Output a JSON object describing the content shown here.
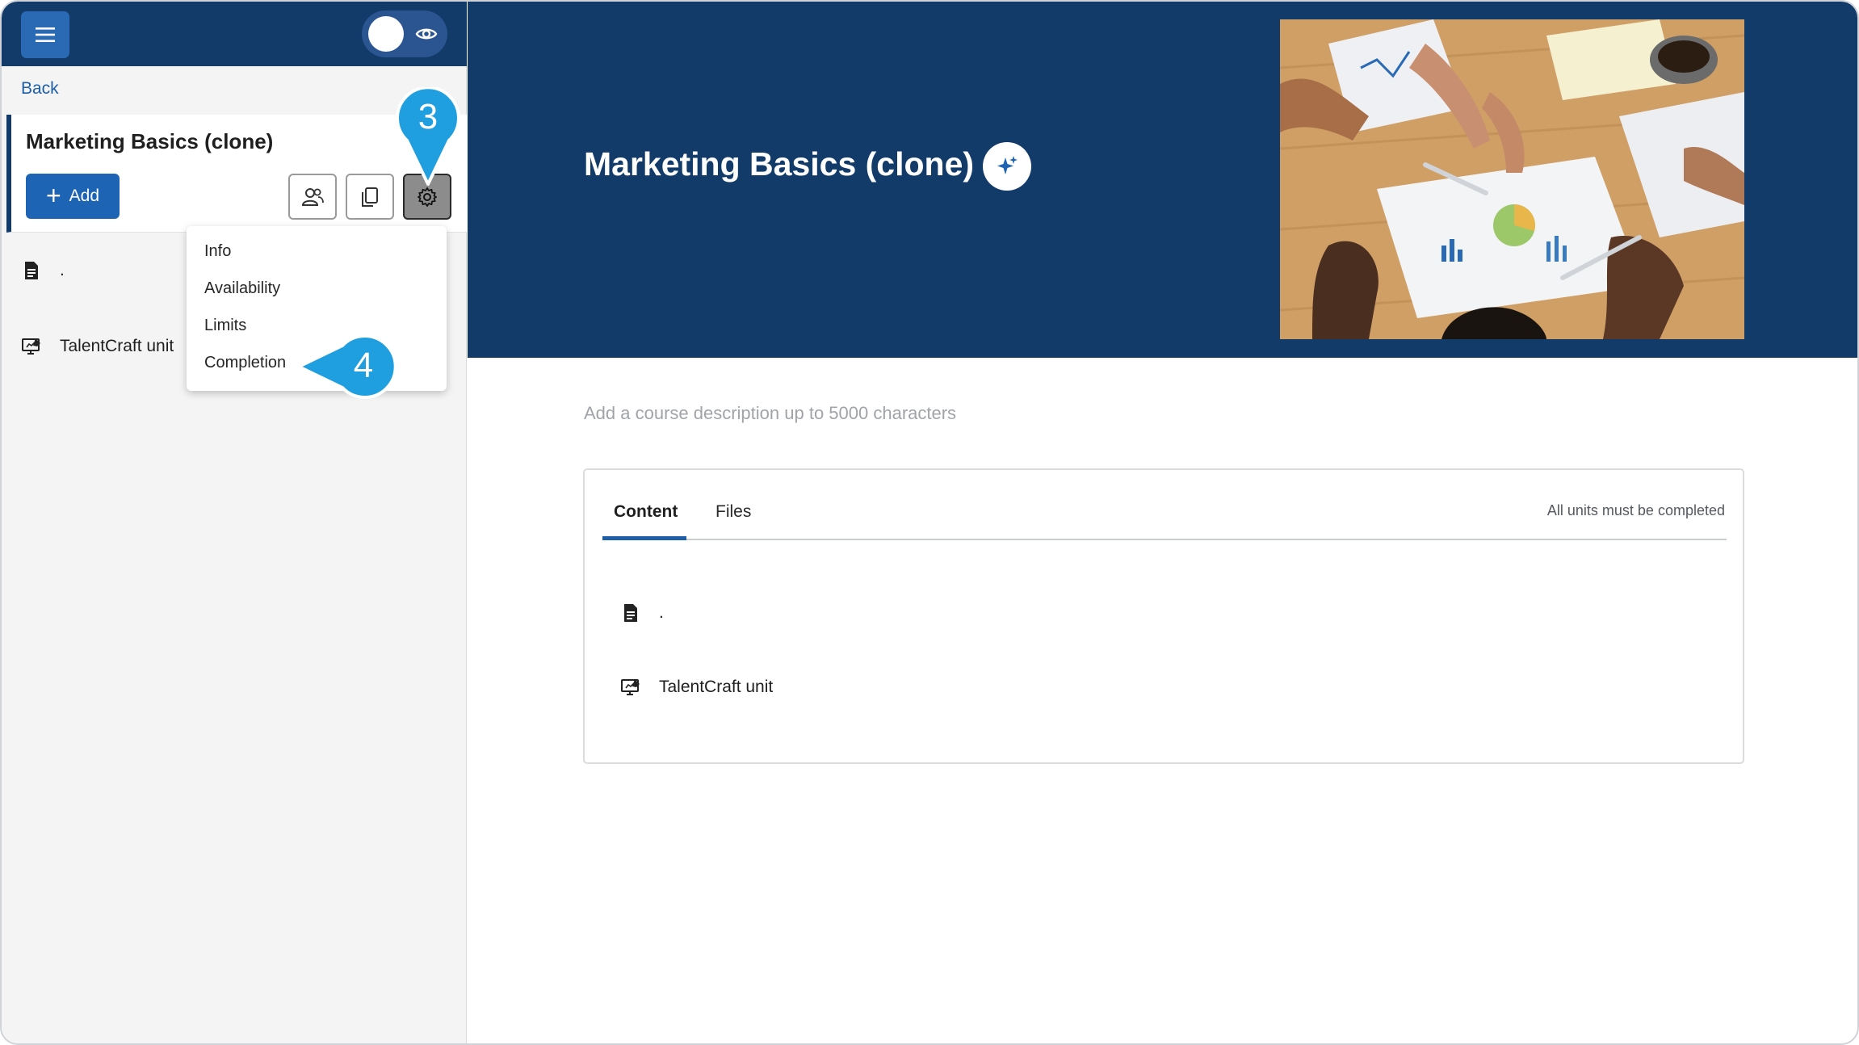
{
  "sidebar": {
    "back_label": "Back",
    "course_title": "Marketing Basics (clone)",
    "add_label": "Add",
    "units": [
      {
        "label": ".",
        "icon": "document-icon"
      },
      {
        "label": "TalentCraft unit",
        "icon": "monitor-edit-icon"
      }
    ],
    "settings_menu": {
      "items": [
        "Info",
        "Availability",
        "Limits",
        "Completion"
      ]
    }
  },
  "callouts": {
    "settings": "3",
    "completion": "4",
    "color": "#1f9ee0"
  },
  "main": {
    "course_title": "Marketing Basics (clone)",
    "description_placeholder": "Add a course description up to 5000 characters",
    "tabs": [
      "Content",
      "Files"
    ],
    "active_tab": "Content",
    "completion_note": "All units must be completed",
    "units": [
      {
        "label": ".",
        "icon": "document-icon"
      },
      {
        "label": "TalentCraft unit",
        "icon": "monitor-edit-icon"
      }
    ]
  },
  "colors": {
    "header_navy": "#133b6a",
    "primary_blue": "#1e64b4",
    "link_blue": "#1d5ea8"
  }
}
